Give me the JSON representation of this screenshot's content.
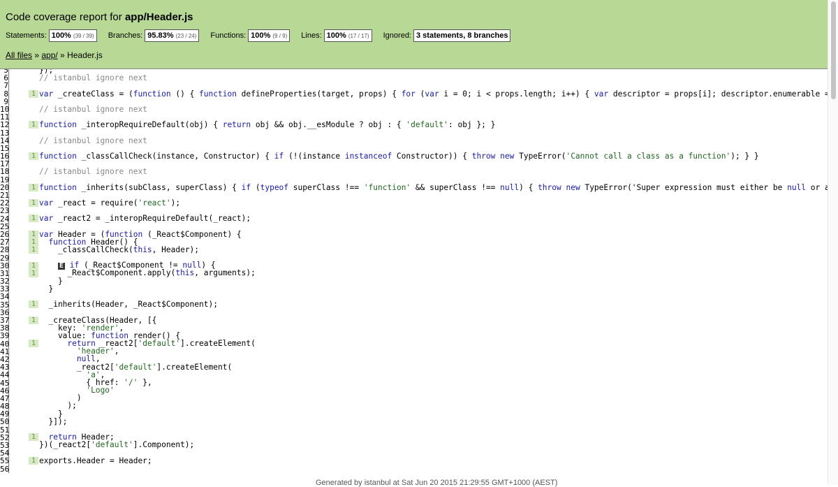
{
  "header": {
    "title_prefix": "Code coverage report for ",
    "title_file": "app/Header.js",
    "stats": [
      {
        "label": "Statements:",
        "pct": "100%",
        "count": "(39 / 39)"
      },
      {
        "label": "Branches:",
        "pct": "95.83%",
        "count": "(23 / 24)"
      },
      {
        "label": "Functions:",
        "pct": "100%",
        "count": "(9 / 9)"
      },
      {
        "label": "Lines:",
        "pct": "100%",
        "count": "(17 / 17)"
      }
    ],
    "ignored_label": "Ignored:",
    "ignored_value": "3 statements, 8 branches"
  },
  "breadcrumb": {
    "all_files": "All files",
    "sep": " » ",
    "dir": "app/",
    "file": "Header.js"
  },
  "code": {
    "line_numbers": [
      "5",
      "6",
      "7",
      "8",
      "9",
      "10",
      "11",
      "12",
      "13",
      "14",
      "15",
      "16",
      "17",
      "18",
      "19",
      "20",
      "21",
      "22",
      "23",
      "24",
      "25",
      "26",
      "27",
      "28",
      "29",
      "30",
      "31",
      "32",
      "33",
      "34",
      "35",
      "36",
      "37",
      "38",
      "39",
      "40",
      "41",
      "42",
      "43",
      "44",
      "45",
      "46",
      "47",
      "48",
      "49",
      "50",
      "51",
      "52",
      "53",
      "54",
      "55",
      "56"
    ],
    "hit_count": "1",
    "lines": [
      "});",
      "// istanbul ignore next",
      "",
      "var _createClass = (function () { function defineProperties(target, props) { for (var i = 0; i < props.length; i++) { var descriptor = props[i]; descriptor.enumerable = d",
      "",
      "// istanbul ignore next",
      "",
      "function _interopRequireDefault(obj) { return obj && obj.__esModule ? obj : { 'default': obj }; }",
      "",
      "// istanbul ignore next",
      "",
      "function _classCallCheck(instance, Constructor) { if (!(instance instanceof Constructor)) { throw new TypeError('Cannot call a class as a function'); } }",
      "",
      "// istanbul ignore next",
      "",
      "function _inherits(subClass, superClass) { if (typeof superClass !== 'function' && superClass !== null) { throw new TypeError('Super expression must either be null or a f",
      "",
      "var _react = require('react');",
      "",
      "var _react2 = _interopRequireDefault(_react);",
      "",
      "var Header = (function (_React$Component) {",
      "  function Header() {",
      "    _classCallCheck(this, Header);",
      "",
      "    if (_React$Component != null) {",
      "      _React$Component.apply(this, arguments);",
      "    }",
      "  }",
      "",
      "  _inherits(Header, _React$Component);",
      "",
      "  _createClass(Header, [{",
      "    key: 'render',",
      "    value: function render() {",
      "      return _react2['default'].createElement(",
      "        'header',",
      "        null,",
      "        _react2['default'].createElement(",
      "          'a',",
      "          { href: '/' },",
      "          'Logo'",
      "        )",
      "      );",
      "    }",
      "  }]);",
      "",
      "  return Header;",
      "})(_react2['default'].Component);",
      "",
      "exports.Header = Header;",
      ""
    ],
    "branch_marker": "E"
  },
  "footer": {
    "text": "Generated by istanbul at Sat Jun 20 2015 21:29:55 GMT+1000 (AEST)"
  },
  "colors": {
    "header_bg": "#b8d895",
    "hit_bg": "#d6ebc3",
    "hit_fg": "#6d8c50"
  }
}
